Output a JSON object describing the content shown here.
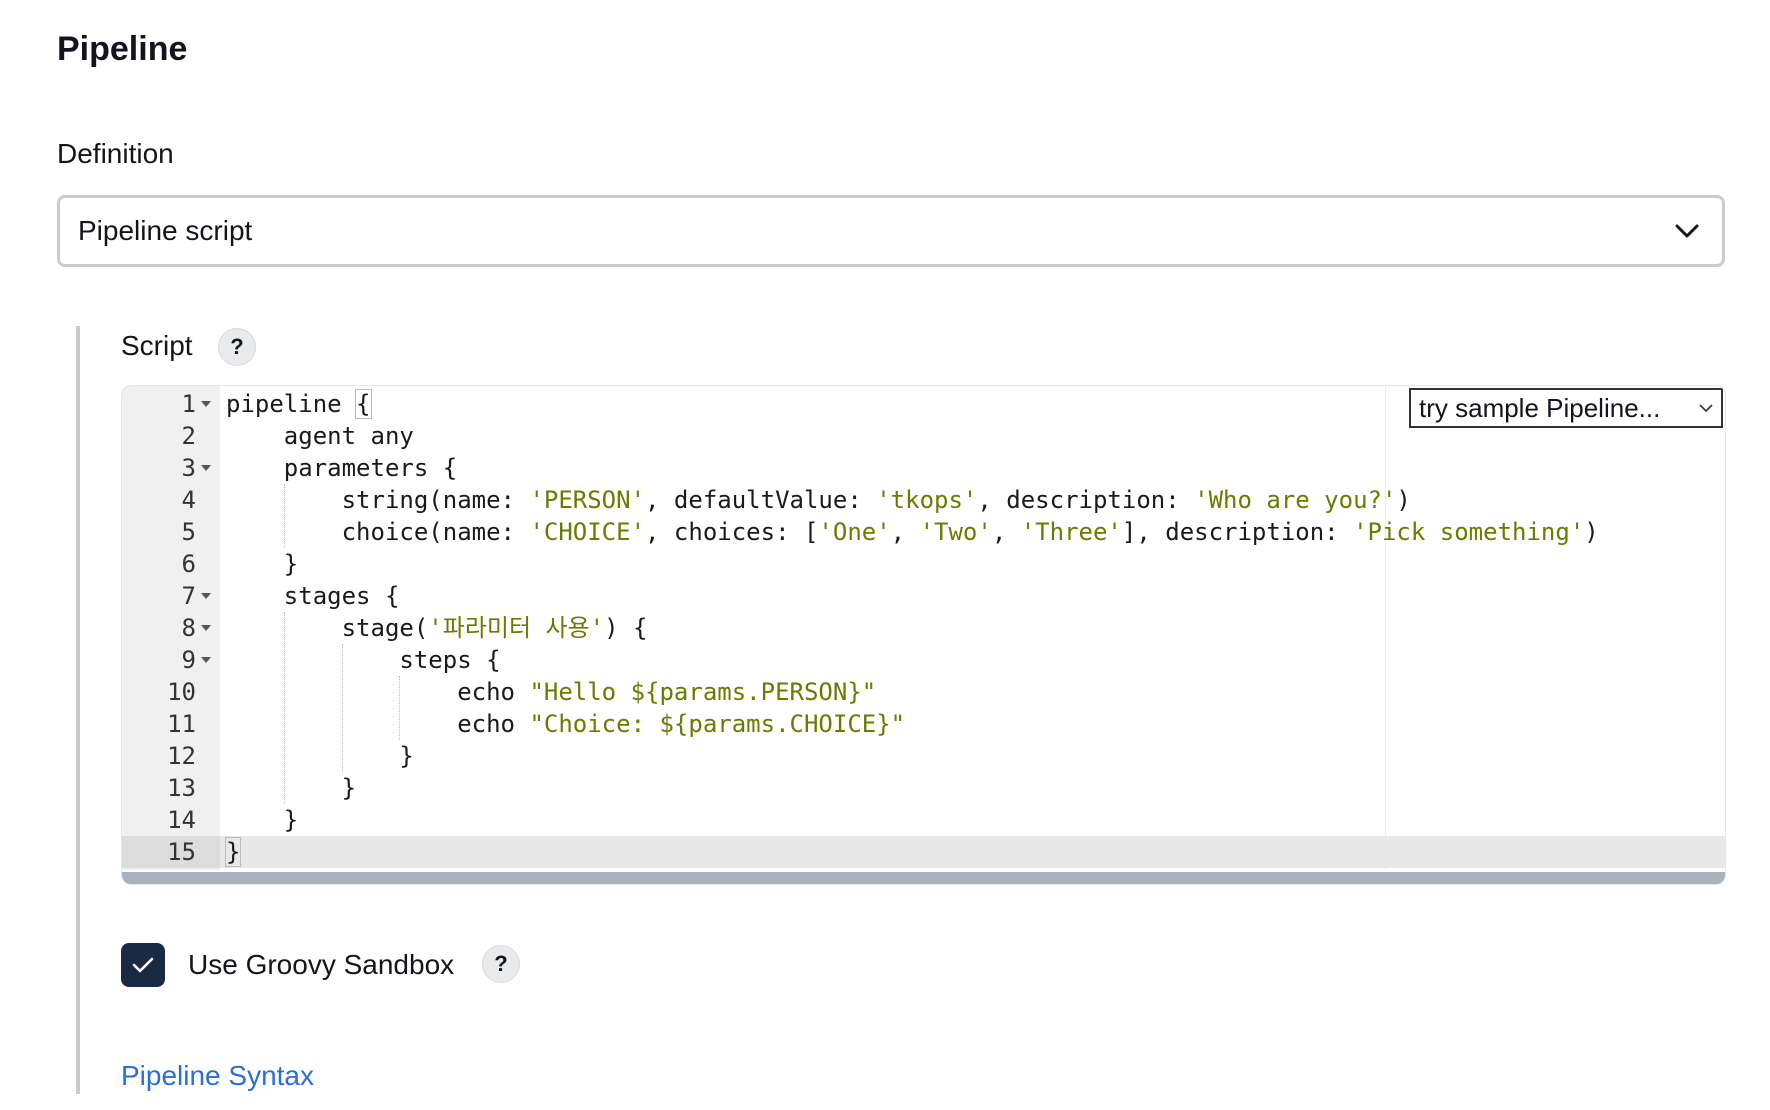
{
  "section": {
    "title": "Pipeline"
  },
  "definition": {
    "label": "Definition",
    "selected": "Pipeline script"
  },
  "script": {
    "label": "Script",
    "help": "?",
    "sample_select": "try sample Pipeline...",
    "line_numbers": [
      "1",
      "2",
      "3",
      "4",
      "5",
      "6",
      "7",
      "8",
      "9",
      "10",
      "11",
      "12",
      "13",
      "14",
      "15"
    ],
    "lines": [
      [
        {
          "t": "pipeline ",
          "c": "plain"
        },
        {
          "t": "{",
          "c": "bracket"
        }
      ],
      [
        {
          "t": "    agent any",
          "c": "plain"
        }
      ],
      [
        {
          "t": "    parameters {",
          "c": "plain"
        }
      ],
      [
        {
          "t": "        string(name: ",
          "c": "plain"
        },
        {
          "t": "'PERSON'",
          "c": "str"
        },
        {
          "t": ", defaultValue: ",
          "c": "plain"
        },
        {
          "t": "'tkops'",
          "c": "str"
        },
        {
          "t": ", description: ",
          "c": "plain"
        },
        {
          "t": "'Who are you?'",
          "c": "str"
        },
        {
          "t": ")",
          "c": "plain"
        }
      ],
      [
        {
          "t": "        choice(name: ",
          "c": "plain"
        },
        {
          "t": "'CHOICE'",
          "c": "str"
        },
        {
          "t": ", choices: [",
          "c": "plain"
        },
        {
          "t": "'One'",
          "c": "str"
        },
        {
          "t": ", ",
          "c": "plain"
        },
        {
          "t": "'Two'",
          "c": "str"
        },
        {
          "t": ", ",
          "c": "plain"
        },
        {
          "t": "'Three'",
          "c": "str"
        },
        {
          "t": "], description: ",
          "c": "plain"
        },
        {
          "t": "'Pick something'",
          "c": "str"
        },
        {
          "t": ")",
          "c": "plain"
        }
      ],
      [
        {
          "t": "    }",
          "c": "plain"
        }
      ],
      [
        {
          "t": "    stages {",
          "c": "plain"
        }
      ],
      [
        {
          "t": "        stage(",
          "c": "plain"
        },
        {
          "t": "'파라미터 사용'",
          "c": "str"
        },
        {
          "t": ") {",
          "c": "plain"
        }
      ],
      [
        {
          "t": "            steps {",
          "c": "plain"
        }
      ],
      [
        {
          "t": "                echo ",
          "c": "plain"
        },
        {
          "t": "\"Hello ${params.PERSON}\"",
          "c": "str"
        }
      ],
      [
        {
          "t": "                echo ",
          "c": "plain"
        },
        {
          "t": "\"Choice: ${params.CHOICE}\"",
          "c": "str"
        }
      ],
      [
        {
          "t": "            }",
          "c": "plain"
        }
      ],
      [
        {
          "t": "        }",
          "c": "plain"
        }
      ],
      [
        {
          "t": "    }",
          "c": "plain"
        }
      ],
      [
        {
          "t": "}",
          "c": "bracket"
        }
      ]
    ],
    "foldable_lines": [
      1,
      3,
      7,
      8,
      9
    ],
    "active_line": 15
  },
  "sandbox": {
    "label": "Use Groovy Sandbox",
    "checked": true,
    "help": "?"
  },
  "syntax_link": {
    "label": "Pipeline Syntax"
  },
  "colors": {
    "string": "#6b7b00",
    "link": "#2b6fd6",
    "checkbox_bg": "#1b2a44",
    "border": "#c8ccd1"
  }
}
